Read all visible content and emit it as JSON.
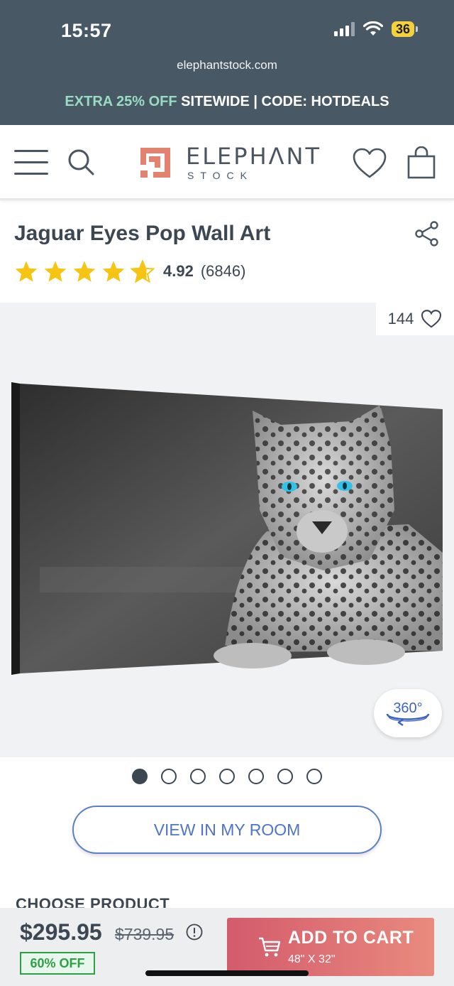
{
  "status_bar": {
    "time": "15:57",
    "battery": "36"
  },
  "browser": {
    "url": "elephantstock.com"
  },
  "promo": {
    "highlight": "EXTRA 25% OFF",
    "rest": "SITEWIDE | CODE: HOTDEALS"
  },
  "header": {
    "logo_main": "ELEPHΛNT",
    "logo_sub": "STOCK"
  },
  "product": {
    "title": "Jaguar Eyes Pop Wall Art",
    "rating": "4.92",
    "rating_count": "(6846)",
    "stars": 4.92,
    "likes": "144"
  },
  "gallery": {
    "badge_360": "360°",
    "total_images": 7,
    "active_index": 0
  },
  "actions": {
    "view_in_room": "VIEW IN MY ROOM"
  },
  "section": {
    "choose_product": "CHOOSE PRODUCT"
  },
  "cart_bar": {
    "price": "$295.95",
    "old_price": "$739.95",
    "discount": "60% OFF",
    "add_to_cart": "ADD TO CART",
    "size": "48\" X 32\""
  },
  "colors": {
    "header_bg": "#485864",
    "accent_blue": "#4f74c8",
    "cart_start": "#d35b6c",
    "cart_end": "#e98a7e",
    "star": "#f6c514",
    "discount_green": "#2e9e47"
  }
}
